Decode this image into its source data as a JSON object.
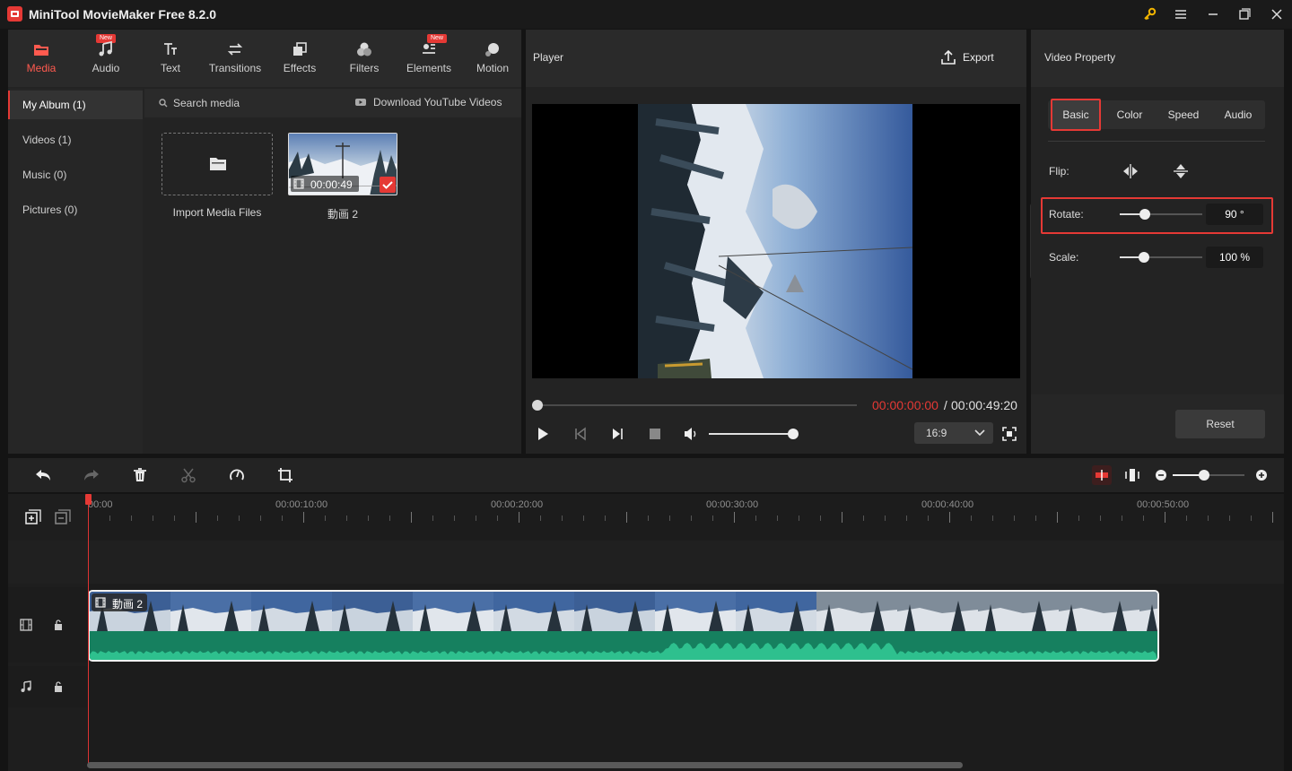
{
  "app": {
    "title": "MiniTool MovieMaker Free 8.2.0"
  },
  "tabs": [
    {
      "label": "Media",
      "icon": "media-icon",
      "active": true
    },
    {
      "label": "Audio",
      "icon": "music-note-icon",
      "badge": "New"
    },
    {
      "label": "Text",
      "icon": "text-icon"
    },
    {
      "label": "Transitions",
      "icon": "transitions-icon"
    },
    {
      "label": "Effects",
      "icon": "effects-icon"
    },
    {
      "label": "Filters",
      "icon": "filters-icon"
    },
    {
      "label": "Elements",
      "icon": "elements-icon",
      "badge": "New"
    },
    {
      "label": "Motion",
      "icon": "motion-icon"
    }
  ],
  "album_nav": [
    "My Album (1)",
    "Videos (1)",
    "Music (0)",
    "Pictures (0)"
  ],
  "media": {
    "search_placeholder": "Search media",
    "download_label": "Download YouTube Videos",
    "import_label": "Import Media Files",
    "clip_name": "動画 2",
    "clip_duration": "00:00:49"
  },
  "player": {
    "title": "Player",
    "export_label": "Export",
    "time_current": "00:00:00:00",
    "time_separator": " / ",
    "time_total": "00:00:49:20",
    "aspect_ratio": "16:9",
    "volume": 1.0,
    "progress": 0.0
  },
  "property": {
    "title": "Video Property",
    "tabs": [
      "Basic",
      "Color",
      "Speed",
      "Audio"
    ],
    "active_tab": "Basic",
    "flip_label": "Flip:",
    "rotate_label": "Rotate:",
    "rotate_value": "90 °",
    "scale_label": "Scale:",
    "scale_value": "100 %",
    "reset_label": "Reset"
  },
  "timeline": {
    "ruler_labels": [
      "00:00",
      "00:00:10:00",
      "00:00:20:00",
      "00:00:30:00",
      "00:00:40:00",
      "00:00:50:00"
    ],
    "clip_label": "動画 2"
  },
  "colors": {
    "accent": "#e53935",
    "waveform": "#16805f"
  }
}
